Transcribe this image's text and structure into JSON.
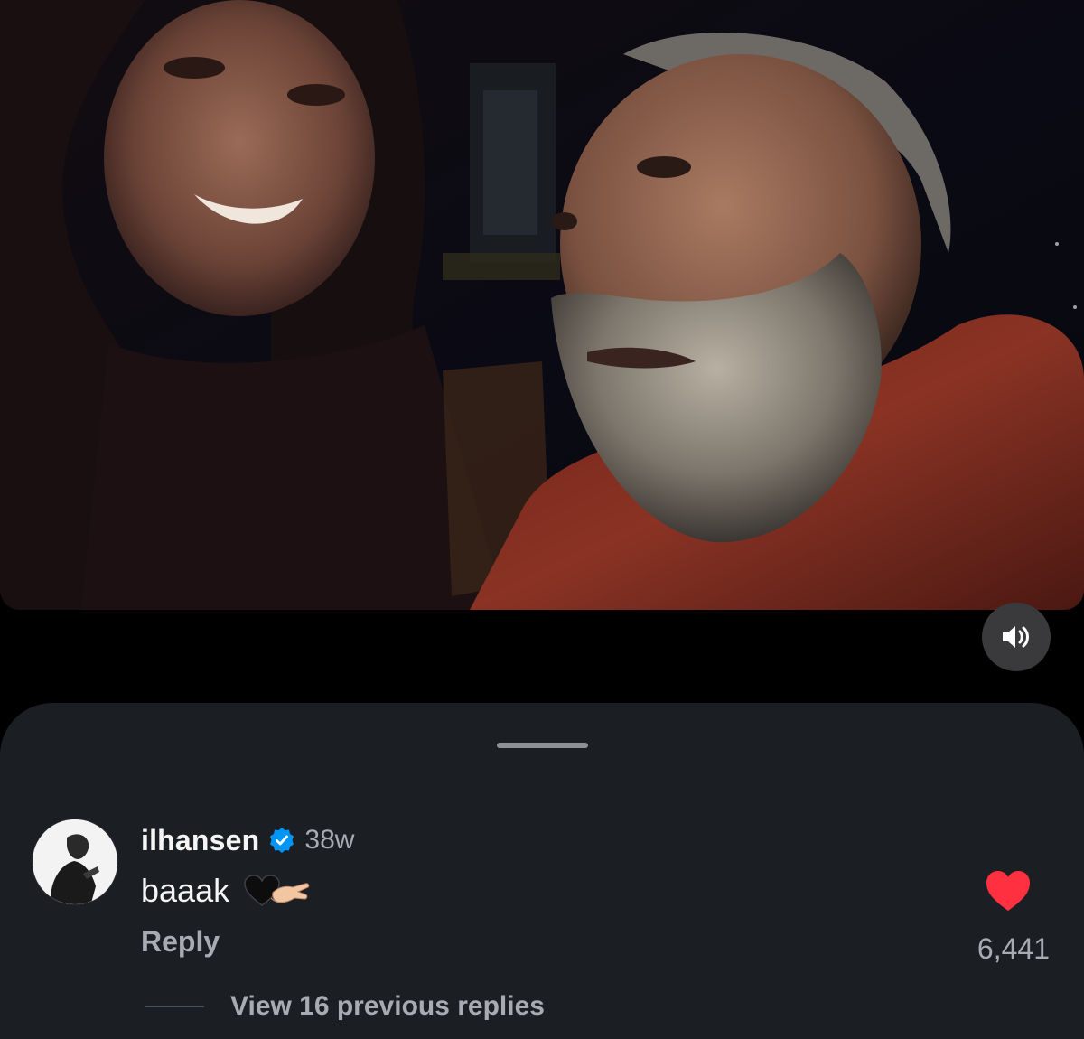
{
  "video": {
    "mute_icon": "speaker-on-icon"
  },
  "comment": {
    "username": "ilhansen",
    "verified_icon": "verified-badge-icon",
    "timestamp": "38w",
    "text": "baaak",
    "emojis": [
      "black-heart-icon",
      "pinching-hand-icon"
    ],
    "reply_label": "Reply",
    "like_icon": "heart-filled-icon",
    "like_count": "6,441",
    "view_replies_label": "View 16 previous replies"
  },
  "colors": {
    "sheet_background": "#1b1f23",
    "like_red": "#ff3040",
    "verified_blue": "#0095f6",
    "secondary_text": "#a8acb2"
  }
}
